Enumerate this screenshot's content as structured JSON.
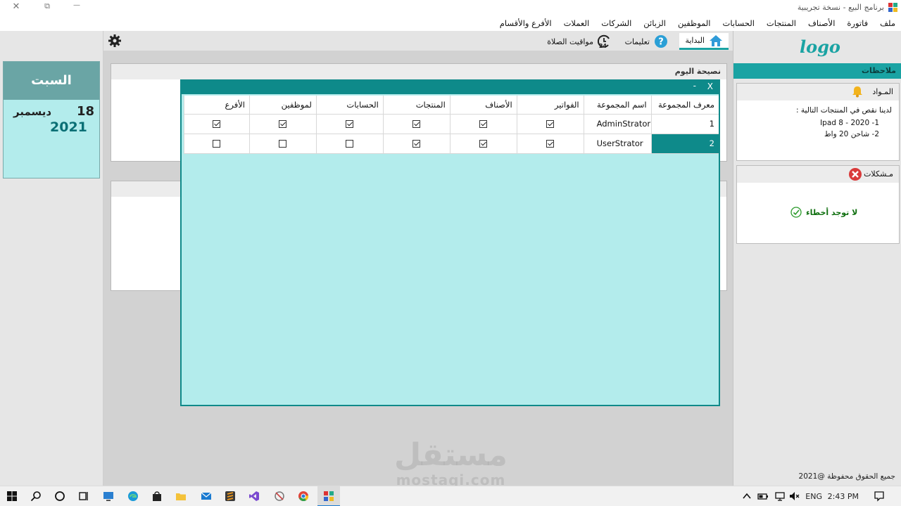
{
  "window": {
    "title": "برنامج البيع - نسخة تجريبية",
    "controls": {
      "close": "✕",
      "restore": "⧉",
      "minimize": "—"
    }
  },
  "menu": [
    "ملف",
    "فاتورة",
    "الأصناف",
    "المنتجات",
    "الحسابات",
    "الموظفين",
    "الزبائن",
    "الشركات",
    "العملات",
    "الأفرع والأقسام"
  ],
  "date_card": {
    "day_name": "السبت",
    "day": "18",
    "month": "ديسمبر",
    "year": "2021"
  },
  "tabs": [
    {
      "label": "البداية",
      "icon": "home-icon",
      "active": true
    },
    {
      "label": "تعليمات",
      "icon": "help-icon",
      "active": false
    },
    {
      "label": "مواقيت الصلاة",
      "icon": "clock-24-icon",
      "active": false
    }
  ],
  "panels": {
    "tip_title": "نصيحة اليوم"
  },
  "dialog": {
    "minimize": "-",
    "close": "X",
    "columns": [
      "معرف المجموعة",
      "اسم المجموعة",
      "الفواتير",
      "الأصناف",
      "المنتجات",
      "الحسابات",
      "لموظفين",
      "الأفرع"
    ],
    "rows": [
      {
        "id": "1",
        "name": "AdminStrator",
        "perms": [
          true,
          true,
          true,
          true,
          true,
          true
        ],
        "selected": false
      },
      {
        "id": "2",
        "name": "UserStrator",
        "perms": [
          true,
          true,
          true,
          false,
          false,
          false
        ],
        "selected": true
      }
    ]
  },
  "right": {
    "logo": "logo",
    "notes_title": "ملاحظات",
    "materials_title": "المـواد",
    "materials_intro": "لدينا نقص في المنتجات التالية :",
    "materials_items": [
      "1- 2020 - 8 Ipad",
      "2- شاحن 20 واط"
    ],
    "problems_title": "مـشكلات",
    "no_errors": "لا توجد أخطاء",
    "copyright": "جميع الحقوق محفوظة @2021"
  },
  "watermark": {
    "line1": "مستقل",
    "line2": "mostaqi.com"
  },
  "taskbar": {
    "lang": "ENG",
    "time": "2:43 PM"
  },
  "colors": {
    "accent": "#1aa3a3",
    "dialog_bg": "#b3ecec",
    "selected": "#0e8a8a"
  }
}
